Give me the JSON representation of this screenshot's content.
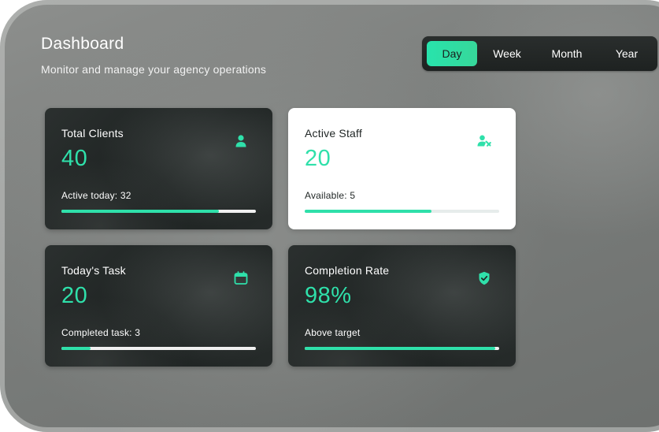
{
  "header": {
    "title": "Dashboard",
    "subtitle": "Monitor and manage your agency operations"
  },
  "range": {
    "options": [
      "Day",
      "Week",
      "Month",
      "Year"
    ],
    "selected": "Day"
  },
  "colors": {
    "accent": "#2fe0aa",
    "card_dark": "#1f2423",
    "card_light": "#ffffff"
  },
  "cards": [
    {
      "label": "Total Clients",
      "value": "40",
      "sub": "Active today: 32",
      "progress": 0.81,
      "icon": "user-icon",
      "theme": "dark"
    },
    {
      "label": "Active Staff",
      "value": "20",
      "sub": "Available: 5",
      "progress": 0.65,
      "icon": "staff-icon",
      "theme": "light"
    },
    {
      "label": "Today's Task",
      "value": "20",
      "sub": "Completed task: 3",
      "progress": 0.15,
      "icon": "calendar-icon",
      "theme": "dark"
    },
    {
      "label": "Completion Rate",
      "value": "98%",
      "sub": "Above target",
      "progress": 0.98,
      "icon": "shield-check-icon",
      "theme": "dark"
    }
  ]
}
